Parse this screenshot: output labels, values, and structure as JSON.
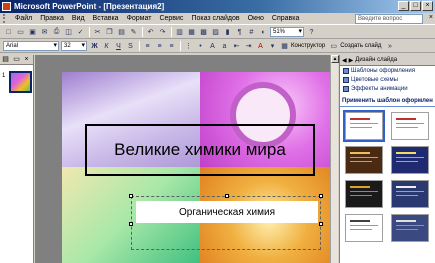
{
  "window": {
    "title": "Microsoft PowerPoint - [Презентация2]"
  },
  "menu": {
    "items": [
      "Файл",
      "Правка",
      "Вид",
      "Вставка",
      "Формат",
      "Сервис",
      "Показ слайдов",
      "Окно",
      "Справка"
    ],
    "ask_placeholder": "Введите вопрос"
  },
  "toolbar": {
    "zoom": "51%"
  },
  "format_toolbar": {
    "font": "Arial",
    "size": "32",
    "designer_label": "Конструктор",
    "new_slide_label": "Создать слайд"
  },
  "slides_pane": {
    "slide_number": "1"
  },
  "slide": {
    "title": "Великие химики мира",
    "subtitle": "Органическая химия"
  },
  "task_pane": {
    "header": "Дизайн слайда",
    "links": [
      "Шаблоны оформления",
      "Цветовые схемы",
      "Эффекты анимации"
    ],
    "section_title": "Применить шаблон оформлен"
  },
  "colors": {
    "title_bar": "#0a246a",
    "selection": "#3060c8"
  }
}
